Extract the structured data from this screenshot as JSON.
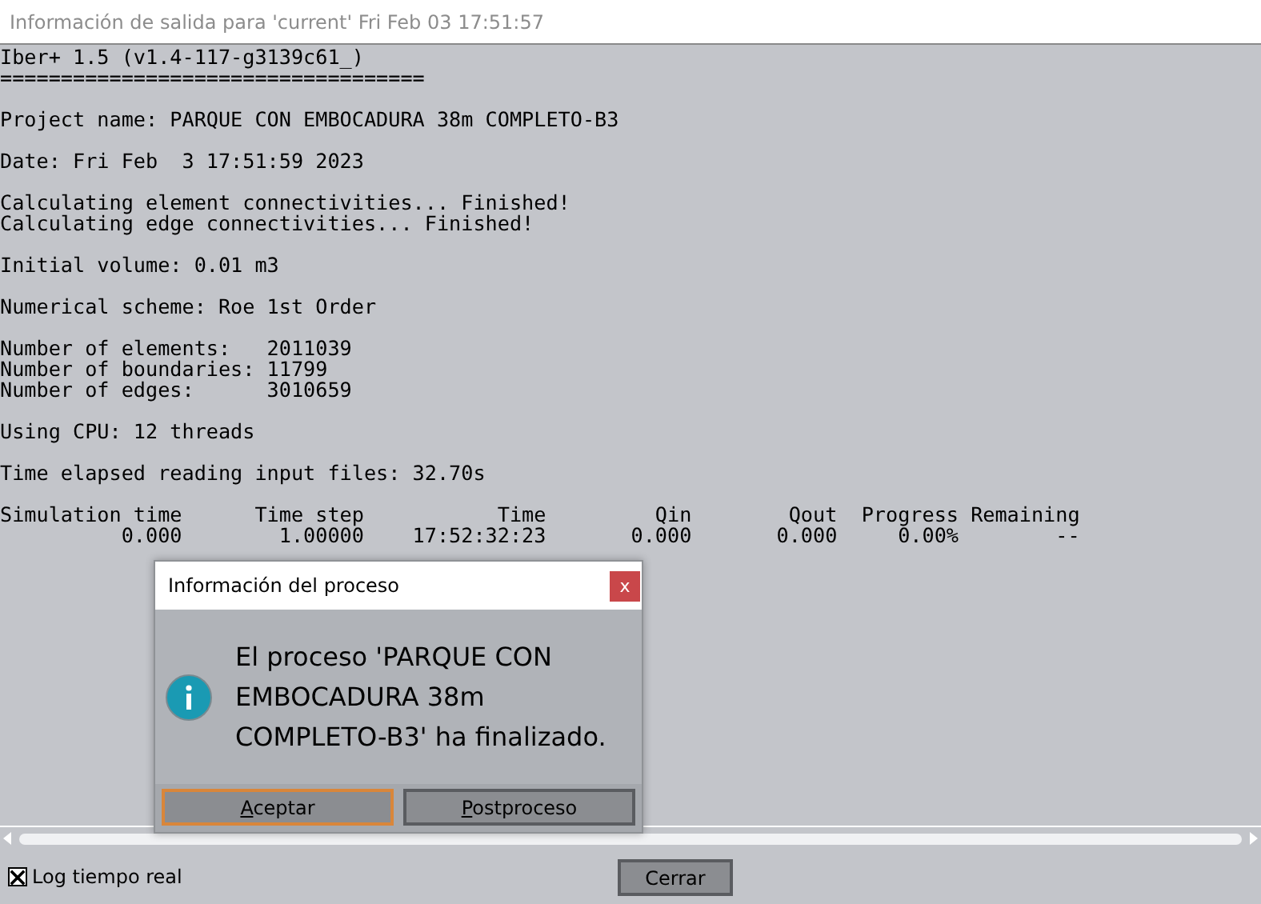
{
  "window": {
    "title": "Información de salida para 'current' Fri Feb 03 17:51:57"
  },
  "console": {
    "blocks": [
      [
        "Iber+ 1.5 (v1.4-117-g3139c61_)",
        "==================================="
      ],
      [
        "Project name: PARQUE CON EMBOCADURA 38m COMPLETO-B3"
      ],
      [
        "Date: Fri Feb  3 17:51:59 2023"
      ],
      [
        "Calculating element connectivities... Finished!",
        "Calculating edge connectivities... Finished!"
      ],
      [
        "Initial volume: 0.01 m3"
      ],
      [
        "Numerical scheme: Roe 1st Order"
      ],
      [
        "Number of elements:   2011039",
        "Number of boundaries: 11799",
        "Number of edges:      3010659"
      ],
      [
        "Using CPU: 12 threads"
      ],
      [
        "Time elapsed reading input files: 32.70s"
      ],
      [
        "Simulation time      Time step           Time         Qin        Qout  Progress Remaining",
        "          0.000        1.00000    17:52:32:23       0.000       0.000     0.00%        --"
      ]
    ]
  },
  "dialog": {
    "title": "Información del proceso",
    "close": "x",
    "message": "El proceso 'PARQUE CON EMBOCADURA 38m COMPLETO-B3' ha finalizado.",
    "buttons": [
      {
        "label": "Aceptar",
        "selected": true
      },
      {
        "label": "Postproceso",
        "selected": false
      }
    ]
  },
  "log_option": {
    "label": "Log tiempo real",
    "checked": true
  },
  "close_button": "Cerrar"
}
